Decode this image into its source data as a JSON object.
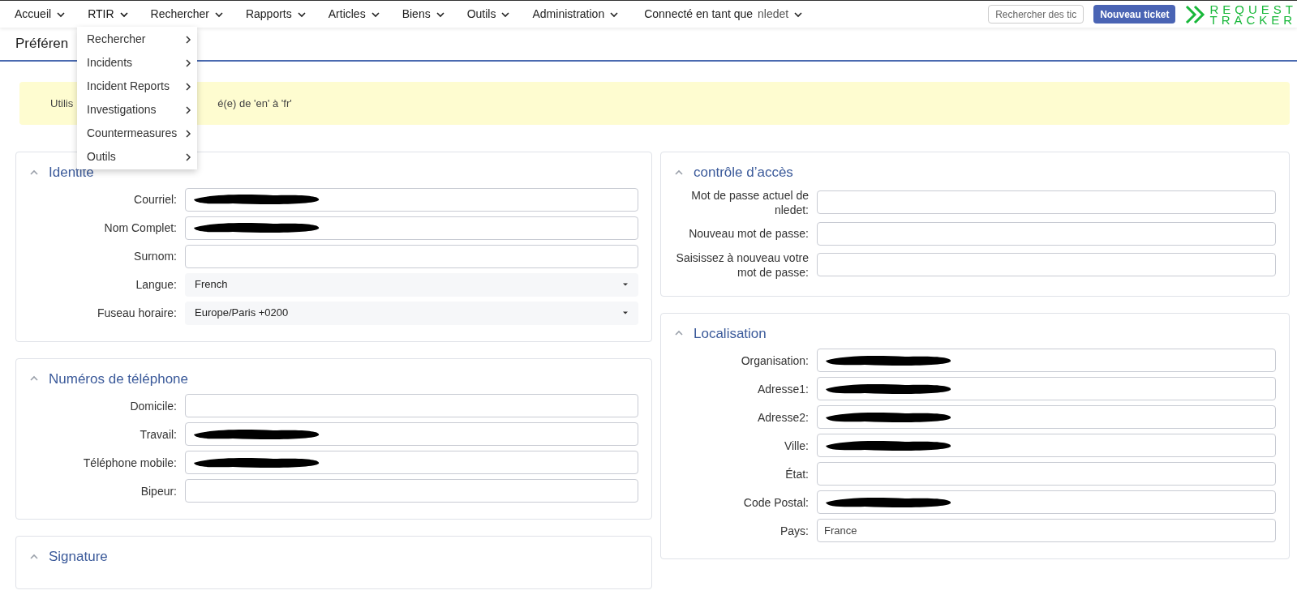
{
  "nav": {
    "items": [
      {
        "label": "Accueil",
        "selected": false
      },
      {
        "label": "RTIR",
        "selected": true
      },
      {
        "label": "Rechercher",
        "selected": false
      },
      {
        "label": "Rapports",
        "selected": false
      },
      {
        "label": "Articles",
        "selected": false
      },
      {
        "label": "Biens",
        "selected": false
      },
      {
        "label": "Outils",
        "selected": false
      },
      {
        "label": "Administration",
        "selected": false
      }
    ],
    "user_prefix": "Connecté en tant que",
    "user": "nledet",
    "search": {
      "placeholder": "Rechercher des tic"
    },
    "new_ticket": "Nouveau ticket",
    "logo": [
      "REQUEST",
      "TRACKER"
    ]
  },
  "dropdown": {
    "items": [
      {
        "label": "Rechercher"
      },
      {
        "label": "Incidents"
      },
      {
        "label": "Incident Reports"
      },
      {
        "label": "Investigations"
      },
      {
        "label": "Countermeasures"
      },
      {
        "label": "Outils"
      }
    ]
  },
  "page_title": "Préféren",
  "banner": {
    "text_start": "Utilis",
    "text_end": "é(e) de 'en' à 'fr'"
  },
  "left": [
    {
      "title": "Identité",
      "expanded": true,
      "fields": [
        {
          "label": "Courriel:",
          "kind": "text",
          "redacted": true
        },
        {
          "label": "Nom Complet:",
          "kind": "text",
          "redacted": true
        },
        {
          "label": "Surnom:",
          "kind": "text",
          "redacted": false
        },
        {
          "label": "Langue:",
          "kind": "select",
          "value": "French"
        },
        {
          "label": "Fuseau horaire:",
          "kind": "select",
          "value": "Europe/Paris +0200"
        }
      ]
    },
    {
      "title": "Numéros de téléphone",
      "expanded": true,
      "fields": [
        {
          "label": "Domicile:",
          "kind": "text",
          "redacted": false
        },
        {
          "label": "Travail:",
          "kind": "text",
          "redacted": true
        },
        {
          "label": "Téléphone mobile:",
          "kind": "text",
          "redacted": true
        },
        {
          "label": "Bipeur:",
          "kind": "text",
          "redacted": false
        }
      ]
    },
    {
      "title": "Signature",
      "expanded": true
    }
  ],
  "right": [
    {
      "title": "contrôle d’accès",
      "expanded": true,
      "fields": [
        {
          "label": "Mot de passe actuel de nledet:",
          "kind": "text",
          "redacted": false
        },
        {
          "label": "Nouveau mot de passe:",
          "kind": "text",
          "redacted": false
        },
        {
          "label": "Saisissez à nouveau votre mot de passe:",
          "kind": "text",
          "redacted": false
        }
      ]
    },
    {
      "title": "Localisation",
      "expanded": true,
      "fields": [
        {
          "label": "Organisation:",
          "kind": "text",
          "redacted": true
        },
        {
          "label": "Adresse1:",
          "kind": "text",
          "redacted": true
        },
        {
          "label": "Adresse2:",
          "kind": "text",
          "redacted": true
        },
        {
          "label": "Ville:",
          "kind": "text",
          "redacted": true
        },
        {
          "label": "État:",
          "kind": "text",
          "redacted": false
        },
        {
          "label": "Code Postal:",
          "kind": "text",
          "redacted": true
        },
        {
          "label": "Pays:",
          "kind": "text",
          "value": "France",
          "redacted": false
        }
      ]
    }
  ]
}
